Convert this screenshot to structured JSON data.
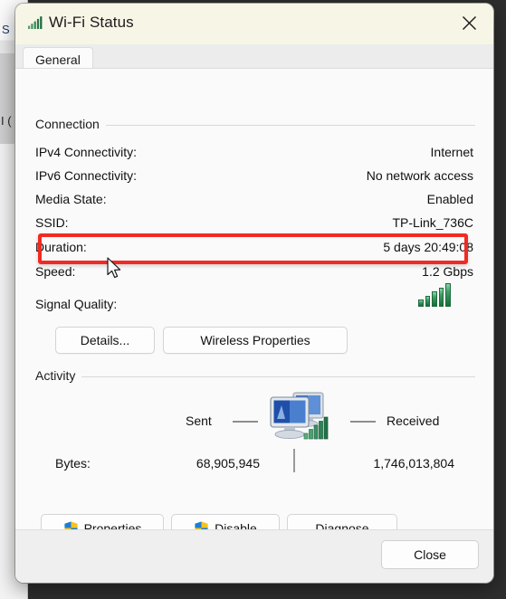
{
  "background": {
    "behind_label_1": "S",
    "behind_label_2": "I ("
  },
  "window": {
    "title": "Wi-Fi Status",
    "title_icon": "wifi-signal-icon",
    "close_icon": "close-x-icon"
  },
  "tabs": [
    {
      "label": "General",
      "selected": true
    }
  ],
  "connection": {
    "group_label": "Connection",
    "rows": [
      {
        "label": "IPv4 Connectivity:",
        "value": "Internet"
      },
      {
        "label": "IPv6 Connectivity:",
        "value": "No network access"
      },
      {
        "label": "Media State:",
        "value": "Enabled"
      },
      {
        "label": "SSID:",
        "value": "TP-Link_736C"
      },
      {
        "label": "Duration:",
        "value": "5 days 20:49:08"
      },
      {
        "label": "Speed:",
        "value": "1.2 Gbps"
      },
      {
        "label": "Signal Quality:",
        "value": ""
      }
    ],
    "signal_quality_bars": 5,
    "buttons": [
      {
        "label": "Details...",
        "shield": false
      },
      {
        "label": "Wireless Properties",
        "shield": false
      }
    ]
  },
  "activity": {
    "group_label": "Activity",
    "sent_label": "Sent",
    "received_label": "Received",
    "bytes_label": "Bytes:",
    "bytes_sent": "68,905,945",
    "bytes_received": "1,746,013,804",
    "icon": "two-monitors-network-icon"
  },
  "actions": [
    {
      "label": "Properties",
      "shield": true
    },
    {
      "label": "Disable",
      "shield": true
    },
    {
      "label": "Diagnose",
      "shield": false
    }
  ],
  "footer": {
    "close_label": "Close"
  },
  "annotation": {
    "target_row": "Duration:",
    "color": "#f12a24"
  },
  "colors": {
    "titlebar": "#f7f5e6",
    "content": "#fafafa",
    "footer": "#efeff0",
    "signal_green": "#1d6b3d",
    "shield_blue": "#0f6cbd",
    "shield_yellow": "#fcc21b",
    "annotation_red": "#f12a24"
  }
}
